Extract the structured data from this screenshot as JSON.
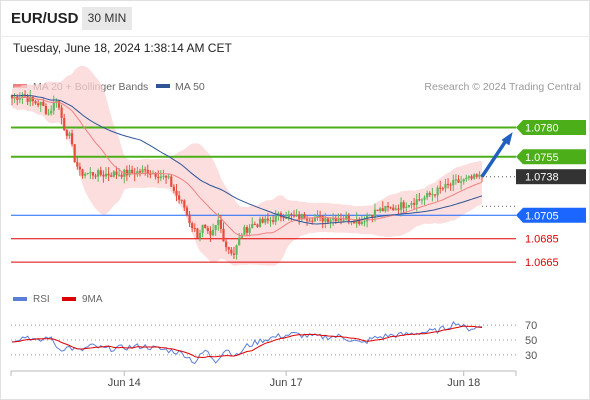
{
  "header": {
    "symbol": "EUR/USD",
    "timeframe": "30 MIN",
    "timestamp": "Tuesday, June 18, 2024 1:38:14 AM CET"
  },
  "legend": {
    "items": [
      {
        "label": "MA 20 + Bollinger Bands",
        "color": "#f08080"
      },
      {
        "label": "MA 50",
        "color": "#2f5597"
      }
    ],
    "credit": "Research © 2024 Trading Central"
  },
  "rsi_legend": {
    "items": [
      {
        "label": "RSI",
        "color": "#5b7fd6"
      },
      {
        "label": "9MA",
        "color": "#dd0000"
      }
    ]
  },
  "colors": {
    "green": "#4caf1a",
    "blue_level": "#1a66ff",
    "red_level": "#dd0000",
    "up_candle": "#5cb85c",
    "down_candle": "#e74c3c",
    "band_fill": "#fbd3d3",
    "ma20": "#f08080",
    "ma50": "#2f5597",
    "rsi": "#5b7fd6",
    "rsi_ma": "#dd0000",
    "current_badge": "#333333",
    "arrow": "#1f5fbf"
  },
  "chart_data": {
    "type": "candlestick",
    "title": "EUR/USD",
    "x_ticks": [
      "Jun 14",
      "Jun 17",
      "Jun 18"
    ],
    "price_range": [
      1.0648,
      1.0795
    ],
    "current_price": "1.0738",
    "levels": [
      {
        "price": 1.078,
        "label": "1.0780",
        "color": "#4caf1a",
        "kind": "resistance"
      },
      {
        "price": 1.0755,
        "label": "1.0755",
        "color": "#4caf1a",
        "kind": "resistance"
      },
      {
        "price": 1.0705,
        "label": "1.0705",
        "color": "#1a66ff",
        "kind": "pivot"
      },
      {
        "price": 1.0685,
        "label": "1.0685",
        "color": "#dd0000",
        "kind": "support"
      },
      {
        "price": 1.0665,
        "label": "1.0665",
        "color": "#dd0000",
        "kind": "support"
      }
    ],
    "price_waypoints": [
      [
        0,
        1.0805
      ],
      [
        4,
        1.0808
      ],
      [
        8,
        1.0802
      ],
      [
        11,
        1.08
      ],
      [
        14,
        1.0792
      ],
      [
        17,
        1.0805
      ],
      [
        20,
        1.078
      ],
      [
        22,
        1.0772
      ],
      [
        24,
        1.0753
      ],
      [
        26,
        1.0741
      ],
      [
        28,
        1.0741
      ],
      [
        34,
        1.074
      ],
      [
        44,
        1.0741
      ],
      [
        52,
        1.0743
      ],
      [
        56,
        1.074
      ],
      [
        60,
        1.0735
      ],
      [
        63,
        1.0722
      ],
      [
        66,
        1.0712
      ],
      [
        68,
        1.07
      ],
      [
        71,
        1.0688
      ],
      [
        73,
        1.0695
      ],
      [
        76,
        1.0685
      ],
      [
        79,
        1.07
      ],
      [
        82,
        1.0679
      ],
      [
        85,
        1.0672
      ],
      [
        88,
        1.069
      ],
      [
        92,
        1.0697
      ],
      [
        98,
        1.07
      ],
      [
        104,
        1.0706
      ],
      [
        108,
        1.0703
      ],
      [
        112,
        1.0704
      ],
      [
        118,
        1.0702
      ],
      [
        124,
        1.0703
      ],
      [
        130,
        1.0702
      ],
      [
        134,
        1.07
      ],
      [
        136,
        1.0705
      ],
      [
        140,
        1.0709
      ],
      [
        146,
        1.0711
      ],
      [
        152,
        1.0716
      ],
      [
        158,
        1.072
      ],
      [
        164,
        1.0727
      ],
      [
        170,
        1.0733
      ],
      [
        176,
        1.0736
      ],
      [
        180,
        1.0738
      ]
    ],
    "rsi_range": [
      15,
      85
    ],
    "rsi_levels": [
      70,
      50,
      30
    ],
    "rsi_waypoints": [
      [
        0,
        50
      ],
      [
        6,
        55
      ],
      [
        10,
        47
      ],
      [
        14,
        55
      ],
      [
        18,
        38
      ],
      [
        22,
        40
      ],
      [
        26,
        35
      ],
      [
        30,
        42
      ],
      [
        36,
        38
      ],
      [
        44,
        40
      ],
      [
        50,
        42
      ],
      [
        56,
        38
      ],
      [
        62,
        35
      ],
      [
        66,
        31
      ],
      [
        70,
        20
      ],
      [
        74,
        36
      ],
      [
        78,
        22
      ],
      [
        82,
        38
      ],
      [
        86,
        28
      ],
      [
        90,
        42
      ],
      [
        96,
        50
      ],
      [
        102,
        55
      ],
      [
        108,
        58
      ],
      [
        114,
        55
      ],
      [
        120,
        54
      ],
      [
        126,
        55
      ],
      [
        130,
        50
      ],
      [
        134,
        45
      ],
      [
        138,
        52
      ],
      [
        144,
        56
      ],
      [
        150,
        57
      ],
      [
        156,
        60
      ],
      [
        162,
        62
      ],
      [
        166,
        66
      ],
      [
        170,
        74
      ],
      [
        174,
        65
      ],
      [
        180,
        68
      ]
    ]
  }
}
